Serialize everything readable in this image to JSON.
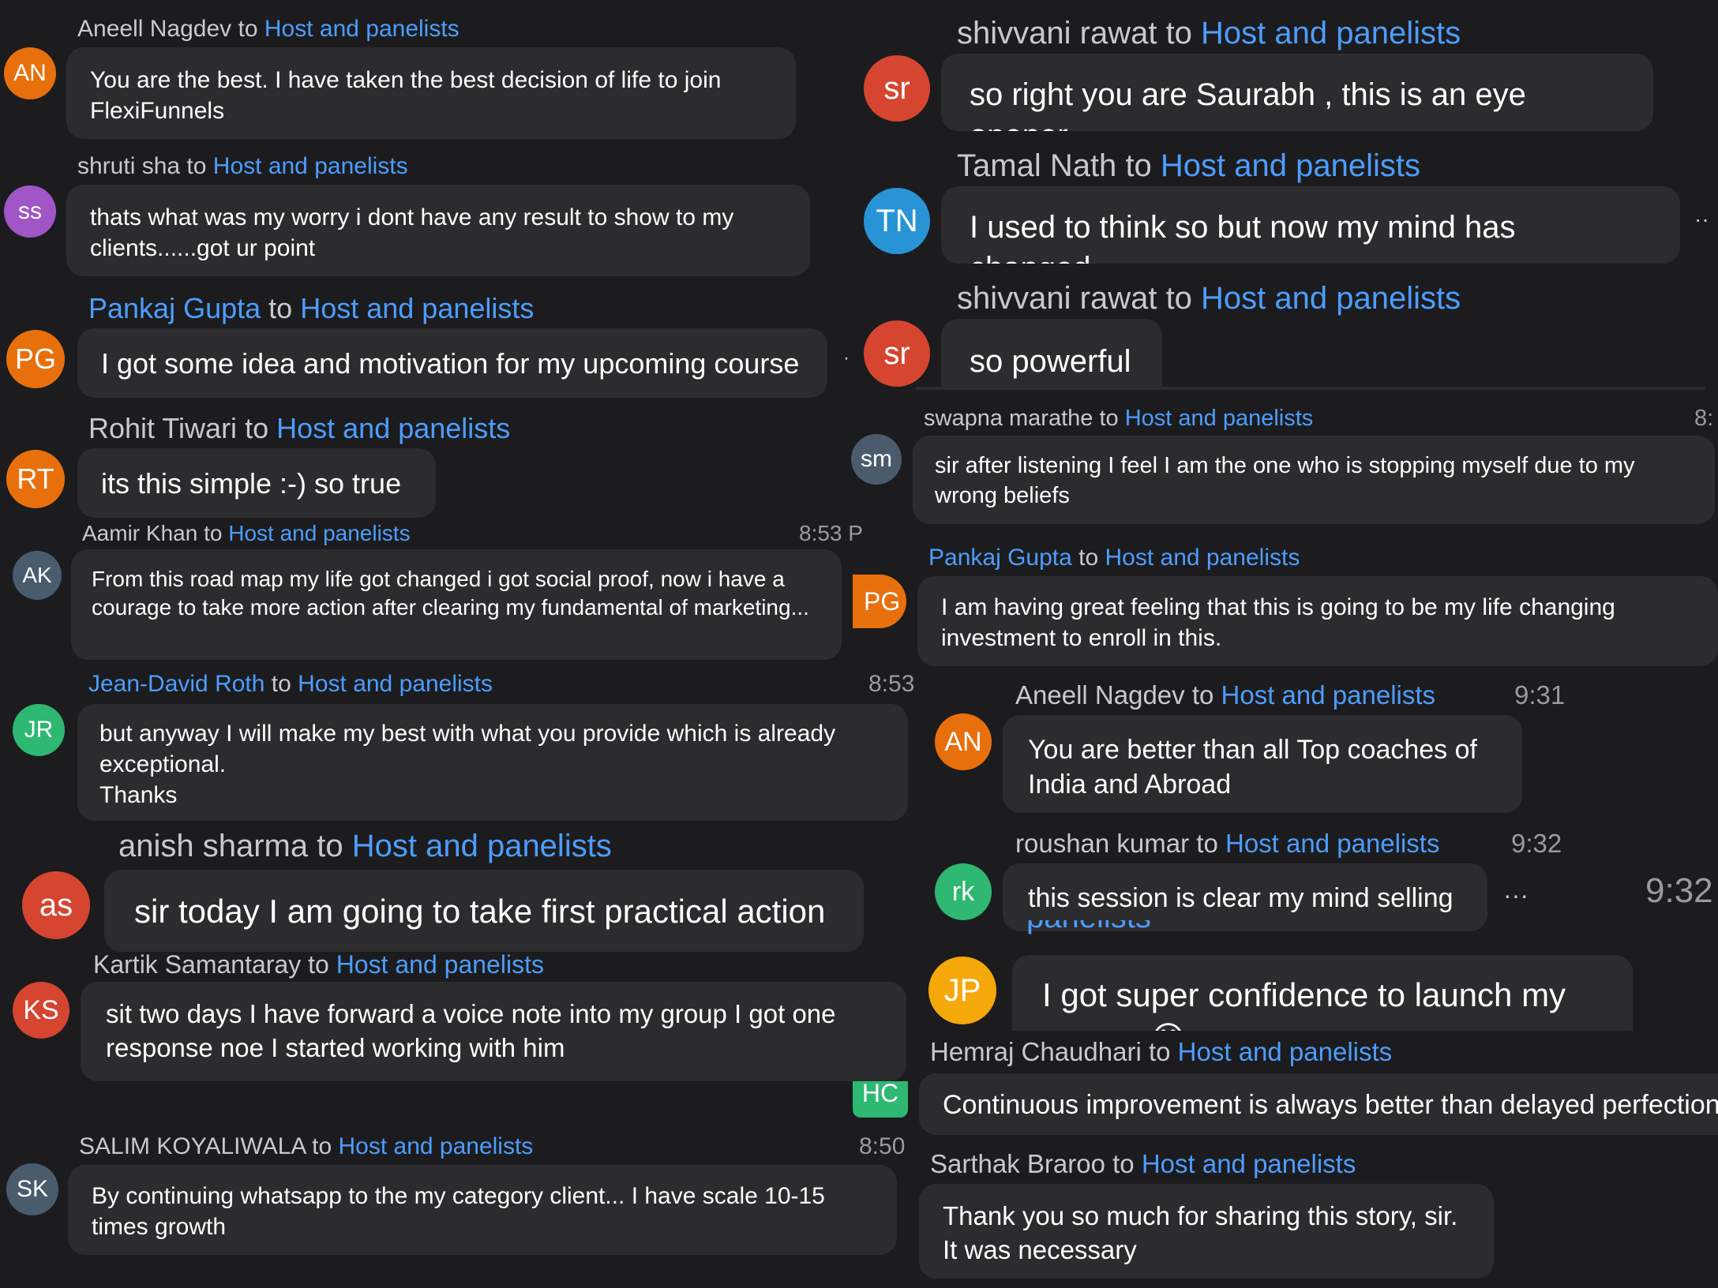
{
  "colors": {
    "background": "#1c1c1e",
    "bubble": "#2c2c2e",
    "link_blue": "#4d9dff",
    "meta_text": "#c9c9cd",
    "avatar_orange": "#e8700c",
    "avatar_purple": "#a056c6",
    "avatar_slate": "#4a5b6e",
    "avatar_green": "#2eb872",
    "avatar_red": "#d64530",
    "avatar_blue": "#2894d6",
    "avatar_yellow": "#f5a80a"
  },
  "common": {
    "to": "to",
    "recipient": "Host and panelists",
    "more_icon": "more-dots-icon"
  },
  "left": [
    {
      "sender": "Aneell Nagdev",
      "initials": "AN",
      "time": "",
      "message": "You are the best. I have taken the best decision of life to join FlexiFunnels"
    },
    {
      "sender": "shruti sha",
      "initials": "ss",
      "time": "",
      "message": "thats what was my worry i dont have any result to show to my clients......got ur point"
    },
    {
      "sender": "Pankaj Gupta",
      "initials": "PG",
      "time": "",
      "message": "I got some idea and motivation for my upcoming course"
    },
    {
      "sender": "Rohit Tiwari",
      "initials": "RT",
      "time": "",
      "message": "its this simple :-) so true"
    },
    {
      "sender": "Aamir Khan",
      "initials": "AK",
      "time": "8:53 P",
      "message": "From this road map my life got changed i got social proof, now i have a courage to take more action after clearing my fundamental of marketing..."
    },
    {
      "sender": "Jean-David Roth",
      "initials": "JR",
      "time": "8:53",
      "message": "but anyway I will make my best with what you provide which is already exceptional.\nThanks"
    },
    {
      "sender": "anish sharma",
      "initials": "as",
      "time": "",
      "message": "sir today I am going to take first practical action"
    },
    {
      "sender": "Kartik Samantaray",
      "initials": "KS",
      "time": "",
      "message": "sit two days I have forward a voice note into my group I got one response noe I started working with him"
    },
    {
      "sender": "",
      "initials": "HC",
      "time": "",
      "message": ""
    },
    {
      "sender": "SALIM KOYALIWALA",
      "initials": "SK",
      "time": "8:50",
      "message": "By continuing whatsapp to the my category client... I have scale 10-15 times growth"
    }
  ],
  "right": [
    {
      "sender": "shivvani rawat",
      "initials": "sr",
      "time": "",
      "message": "so right you are Saurabh , this is an eye opener"
    },
    {
      "sender": "Tamal Nath",
      "initials": "TN",
      "time": "",
      "message": "I used to think so but now my mind has changed."
    },
    {
      "sender": "shivvani rawat",
      "initials": "sr",
      "time": "",
      "message": "so powerful"
    },
    {
      "sender": "swapna marathe",
      "initials": "sm",
      "time": "8:",
      "message": "sir after listening I feel I am the one who is stopping myself due to my wrong beliefs"
    },
    {
      "sender": "Pankaj Gupta",
      "initials": "PG",
      "time": "",
      "message": "I am having great feeling that this is going to be my life changing investment to enroll in this."
    },
    {
      "sender": "Aneell Nagdev",
      "initials": "AN",
      "time": "9:31",
      "message": "You are better than all Top coaches of India and Abroad"
    },
    {
      "sender": "roushan kumar",
      "initials": "rk",
      "time": "9:32",
      "side_time": "9:32",
      "message": "this session is clear my mind selling"
    },
    {
      "sender": "panelists",
      "initials": "JP",
      "time": "",
      "message": "I got super confidence to launch my course 😊"
    },
    {
      "sender": "Hemraj Chaudhari",
      "initials": "",
      "time": "",
      "message": "Continuous improvement is always better than delayed perfection"
    },
    {
      "sender": "Sarthak Braroo",
      "initials": "",
      "time": "",
      "message": "Thank you so much for sharing this story, sir.\nIt was necessary"
    }
  ]
}
